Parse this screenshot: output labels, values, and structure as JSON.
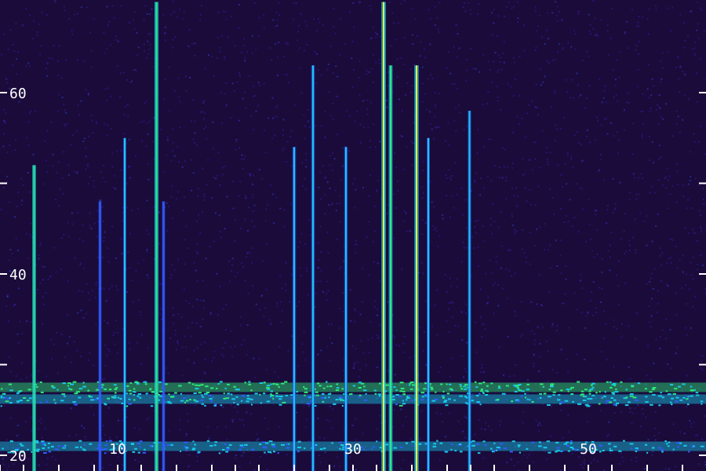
{
  "chart_data": {
    "type": "heatmap",
    "title": "",
    "xlabel": "",
    "ylabel": "",
    "xlim": [
      0,
      60
    ],
    "ylim": [
      20,
      70
    ],
    "x_tick_labels": [
      {
        "value": 10,
        "label": "10"
      },
      {
        "value": 30,
        "label": "30"
      },
      {
        "value": 50,
        "label": "50"
      }
    ],
    "y_tick_labels": [
      {
        "value": 20,
        "label": "20"
      },
      {
        "value": 40,
        "label": "40"
      },
      {
        "value": 60,
        "label": "60"
      }
    ],
    "y_minor_ticks": [
      30,
      50
    ],
    "x_ticks": [
      0,
      2,
      5,
      8,
      10,
      12,
      15,
      18,
      20,
      22,
      25,
      28,
      30,
      32,
      35,
      38,
      40,
      42,
      45,
      48,
      50,
      52,
      55,
      58
    ],
    "colorscale": [
      "#1a0b3a",
      "#3a1a9a",
      "#2f5bff",
      "#19c8e8",
      "#2ee87a",
      "#e9f03a"
    ],
    "background_color": "#1a0b3a",
    "vertical_lines": [
      {
        "x": 2.9,
        "y_top": 52,
        "intensity": 0.7
      },
      {
        "x": 8.5,
        "y_top": 48,
        "intensity": 0.4
      },
      {
        "x": 10.6,
        "y_top": 55,
        "intensity": 0.5
      },
      {
        "x": 13.3,
        "y_top": 70,
        "intensity": 0.8
      },
      {
        "x": 13.9,
        "y_top": 48,
        "intensity": 0.4
      },
      {
        "x": 25.0,
        "y_top": 54,
        "intensity": 0.6
      },
      {
        "x": 26.6,
        "y_top": 63,
        "intensity": 0.6
      },
      {
        "x": 29.4,
        "y_top": 54,
        "intensity": 0.6
      },
      {
        "x": 32.6,
        "y_top": 70,
        "intensity": 0.95
      },
      {
        "x": 33.2,
        "y_top": 63,
        "intensity": 0.7
      },
      {
        "x": 35.4,
        "y_top": 63,
        "intensity": 0.9
      },
      {
        "x": 36.4,
        "y_top": 55,
        "intensity": 0.5
      },
      {
        "x": 39.9,
        "y_top": 58,
        "intensity": 0.5
      }
    ],
    "horizontal_bands": [
      {
        "y": 27.5,
        "intensity": 0.75
      },
      {
        "y": 26.2,
        "intensity": 0.6
      },
      {
        "y": 21.0,
        "intensity": 0.55
      }
    ]
  }
}
